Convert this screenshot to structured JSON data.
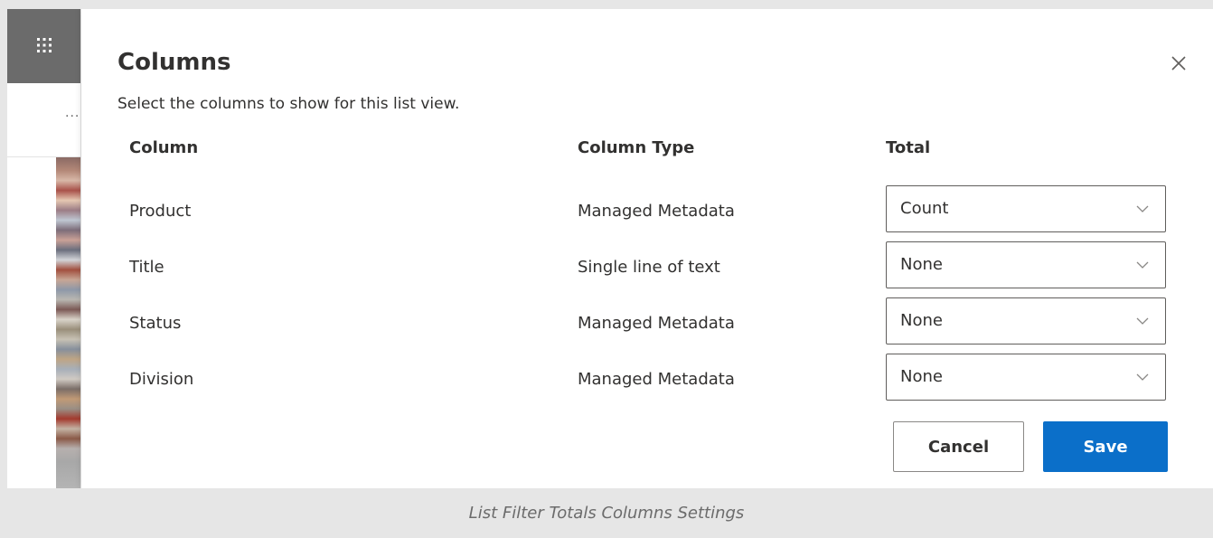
{
  "panel": {
    "title": "Columns",
    "description": "Select the columns to show for this list view.",
    "close_icon": "close-icon"
  },
  "rail": {
    "app_launcher_icon": "waffle-icon",
    "ellipsis": "..."
  },
  "table": {
    "headers": {
      "column": "Column",
      "type": "Column Type",
      "total": "Total"
    },
    "rows": [
      {
        "column": "Product",
        "type": "Managed Metadata",
        "total": "Count"
      },
      {
        "column": "Title",
        "type": "Single line of text",
        "total": "None"
      },
      {
        "column": "Status",
        "type": "Managed Metadata",
        "total": "None"
      },
      {
        "column": "Division",
        "type": "Managed Metadata",
        "total": "None"
      }
    ],
    "dropdown_icon": "chevron-down-icon"
  },
  "actions": {
    "cancel_label": "Cancel",
    "save_label": "Save"
  },
  "caption": "List Filter Totals Columns Settings",
  "colors": {
    "primary": "#0b6fc9",
    "text": "#323130",
    "rail_header": "#6b6b6b"
  }
}
